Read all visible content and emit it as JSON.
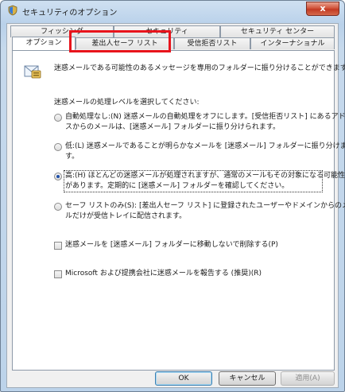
{
  "window": {
    "title": "セキュリティのオプション",
    "close_glyph": "x"
  },
  "tabs": {
    "back_row": [
      "フィッシング",
      "セキュリティ",
      "セキュリティ センター"
    ],
    "front_row": [
      "オプション",
      "差出人セーフ リスト",
      "受信拒否リスト",
      "インターナショナル"
    ]
  },
  "options": {
    "intro": "迷惑メールである可能性のあるメッセージを専用のフォルダーに振り分けることができます。",
    "level_label": "迷惑メールの処理レベルを選択してください:",
    "radios": [
      {
        "line1": "自動処理なし:(N) 迷惑メールの自動処理をオフにします。[受信拒否リスト] にあるアドレ",
        "line2": "スからのメールは、[迷惑メール] フォルダーに振り分けられます。",
        "checked": false
      },
      {
        "line1": "低:(L) 迷惑メールであることが明らかなメールを [迷惑メール] フォルダーに振り分けま",
        "line2": "す。",
        "checked": false
      },
      {
        "line1": "高:(H) ほとんどの迷惑メールが処理されますが、通常のメールもその対象になる可能性",
        "line2": "があります。定期的に [迷惑メール] フォルダーを確認してください。",
        "checked": true
      },
      {
        "line1": "セーフ リストのみ(S): [差出人セーフ リスト] に登録されたユーザーやドメインからのメー",
        "line2": "ルだけが受信トレイに配信されます。",
        "checked": false
      }
    ],
    "checkbox_delete": "迷惑メールを [迷惑メール] フォルダーに移動しないで削除する(P)",
    "checkbox_report": "Microsoft および提携会社に迷惑メールを報告する (推奨)(R)"
  },
  "buttons": {
    "ok": "OK",
    "cancel": "キャンセル",
    "apply": "適用(A)"
  },
  "colors": {
    "highlight": "#e8141c",
    "accent": "#1f4fa8"
  }
}
